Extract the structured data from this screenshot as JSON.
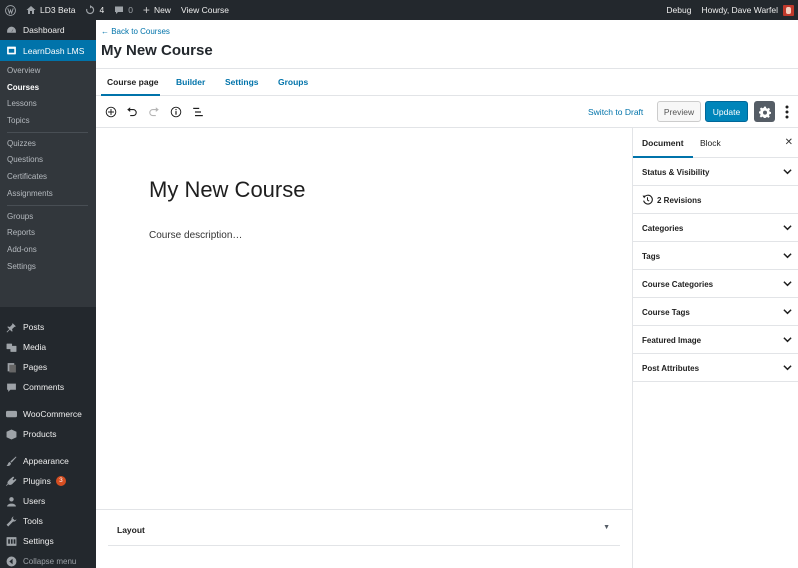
{
  "admin_bar": {
    "site_name": "LD3 Beta",
    "updates_count": "4",
    "comments_count": "0",
    "new_label": "New",
    "view_label": "View Course",
    "debug_label": "Debug",
    "greeting": "Howdy, Dave Warfel"
  },
  "sidebar": {
    "dashboard": "Dashboard",
    "learndash": "LearnDash LMS",
    "learndash_sub": [
      "Overview",
      "Courses",
      "Lessons",
      "Topics",
      "Quizzes",
      "Questions",
      "Certificates",
      "Assignments",
      "Groups",
      "Reports",
      "Add-ons",
      "Settings"
    ],
    "posts": "Posts",
    "media": "Media",
    "pages": "Pages",
    "comments": "Comments",
    "woocommerce": "WooCommerce",
    "products": "Products",
    "appearance": "Appearance",
    "plugins": "Plugins",
    "plugins_badge": "3",
    "users": "Users",
    "tools": "Tools",
    "settings": "Settings",
    "collapse": "Collapse menu"
  },
  "header": {
    "back_link": "← Back to Courses",
    "title": "My New Course",
    "tabs": [
      "Course page",
      "Builder",
      "Settings",
      "Groups"
    ]
  },
  "toolbar": {
    "switch_draft": "Switch to Draft",
    "preview": "Preview",
    "update": "Update"
  },
  "editor": {
    "post_title": "My New Course",
    "post_description": "Course description…",
    "layout_label": "Layout"
  },
  "panel": {
    "tabs": [
      "Document",
      "Block"
    ],
    "sections": {
      "status": "Status & Visibility",
      "revisions": "2 Revisions",
      "categories": "Categories",
      "tags": "Tags",
      "course_categories": "Course Categories",
      "course_tags": "Course Tags",
      "featured_image": "Featured Image",
      "post_attributes": "Post Attributes"
    }
  },
  "colors": {
    "admin_dark": "#23282d",
    "submenu_bg": "#32373c",
    "accent": "#0073aa",
    "update_button": "#0085ba",
    "badge": "#d54e21"
  }
}
